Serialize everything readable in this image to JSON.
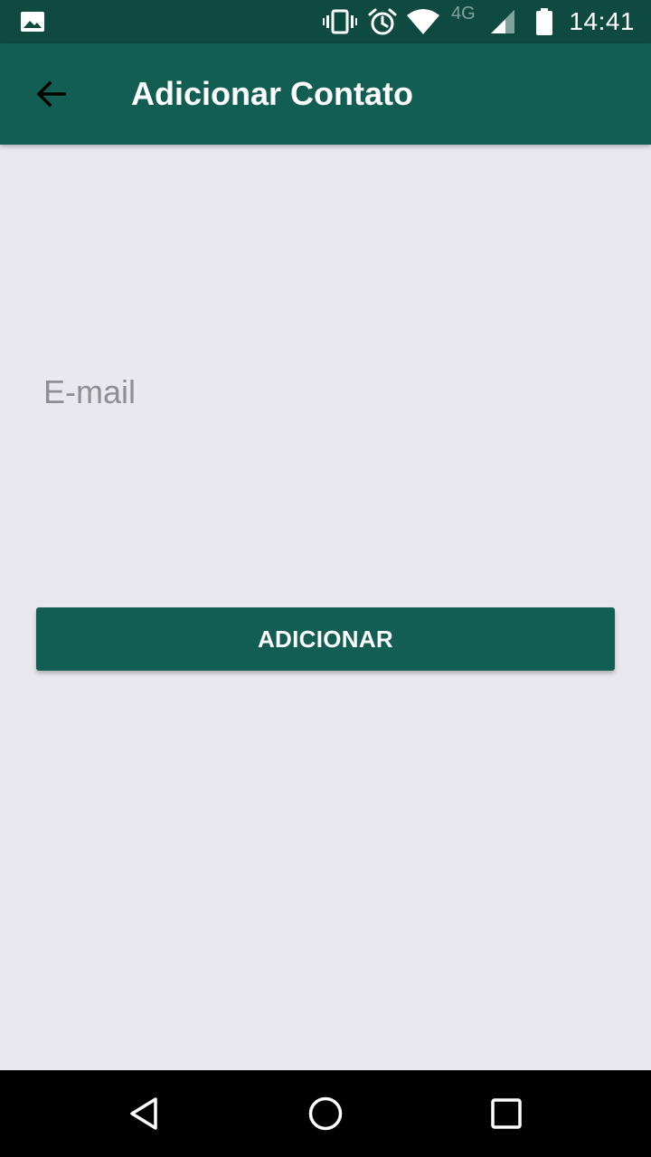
{
  "status_bar": {
    "time": "14:41",
    "network_type": "4G",
    "icons": [
      "image-notification-icon",
      "vibrate-icon",
      "alarm-icon",
      "wifi-icon",
      "cell-signal-icon",
      "battery-icon"
    ]
  },
  "app_bar": {
    "title": "Adicionar Contato",
    "back_icon": "arrow-back-icon",
    "background_color": "#135e53"
  },
  "form": {
    "email_placeholder": "E-mail",
    "email_value": "",
    "submit_label": "ADICIONAR"
  },
  "nav_bar": {
    "icons": [
      "back-triangle-icon",
      "home-circle-icon",
      "recents-square-icon"
    ]
  },
  "colors": {
    "status_bar": "#0f4a40",
    "primary": "#135e53",
    "background": "#e8e8ee"
  }
}
